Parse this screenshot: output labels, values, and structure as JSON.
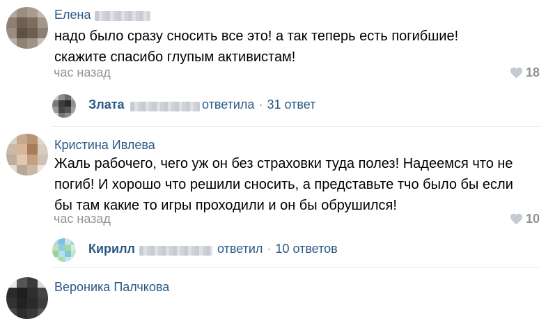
{
  "comments": [
    {
      "author": "Елена",
      "text": "надо было сразу сносить все это! а так теперь есть погибшие! скажите спасибо глупым активистам!",
      "time": "час назад",
      "likes": "18",
      "reply": {
        "author": "Злата",
        "verb": "ответила",
        "count": "31 ответ"
      }
    },
    {
      "author": "Кристина Ивлева",
      "text": "Жаль рабочего, чего уж он без страховки туда полез! Надеемся что не погиб! И хорошо что решили сносить, а представьте тчо было бы если бы там какие то игры проходили и он бы обрушился!",
      "time": "час назад",
      "likes": "10",
      "reply": {
        "author": "Кирилл",
        "verb": "ответил",
        "count": "10 ответов"
      }
    },
    {
      "author": "Вероника Палчкова"
    }
  ],
  "separator": "·",
  "icons": {
    "like": "heart-icon"
  },
  "colors": {
    "link": "#2a5885",
    "meta": "#939393",
    "divider": "#e7e8ec"
  }
}
